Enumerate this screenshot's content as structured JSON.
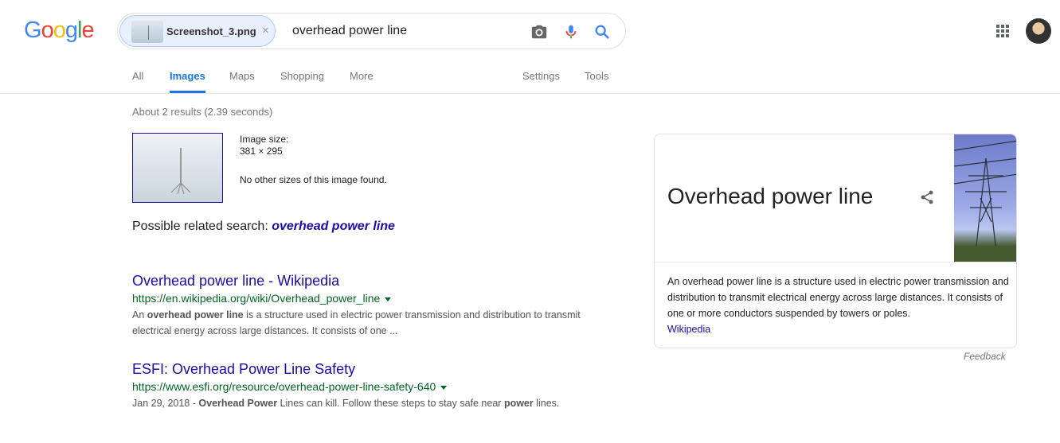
{
  "header": {
    "logo_letters": [
      "G",
      "o",
      "o",
      "g",
      "l",
      "e"
    ],
    "logo_colors": [
      "#4285F4",
      "#EA4335",
      "#FBBC05",
      "#4285F4",
      "#34A853",
      "#EA4335"
    ],
    "chip_label": "Screenshot_3.png",
    "chip_close": "×",
    "query": "overhead power line",
    "icons": [
      "camera-icon",
      "microphone-icon",
      "search-icon",
      "apps-grid-icon",
      "avatar"
    ]
  },
  "tabs": {
    "all": "All",
    "images": "Images",
    "maps": "Maps",
    "shopping": "Shopping",
    "more": "More",
    "settings": "Settings",
    "tools": "Tools"
  },
  "stats": "About 2 results (2.39 seconds)",
  "image_info": {
    "size_label": "Image size:",
    "size_value": "381 × 295",
    "no_other": "No other sizes of this image found."
  },
  "related": {
    "prefix": "Possible related search:",
    "term": "overhead power line"
  },
  "results": [
    {
      "title": "Overhead power line - Wikipedia",
      "url": "https://en.wikipedia.org/wiki/Overhead_power_line",
      "snippet_parts": [
        "An ",
        "overhead power line",
        " is a structure used in electric power transmission and distribution to transmit electrical energy across large distances. It consists of one ..."
      ]
    },
    {
      "title": "ESFI: Overhead Power Line Safety",
      "url": "https://www.esfi.org/resource/overhead-power-line-safety-640",
      "snippet_parts": [
        "Jan 29, 2018 - ",
        "Overhead Power",
        " Lines can kill. Follow these steps to stay safe near ",
        "power",
        " lines."
      ]
    }
  ],
  "knowledge_panel": {
    "title": "Overhead power line",
    "description": "An overhead power line is a structure used in electric power transmission and distribution to transmit electrical energy across large distances. It consists of one or more conductors suspended by towers or poles.",
    "source": "Wikipedia",
    "feedback": "Feedback"
  },
  "colors": {
    "link": "#1a0dab",
    "url": "#006621",
    "accent": "#1a73e8"
  }
}
